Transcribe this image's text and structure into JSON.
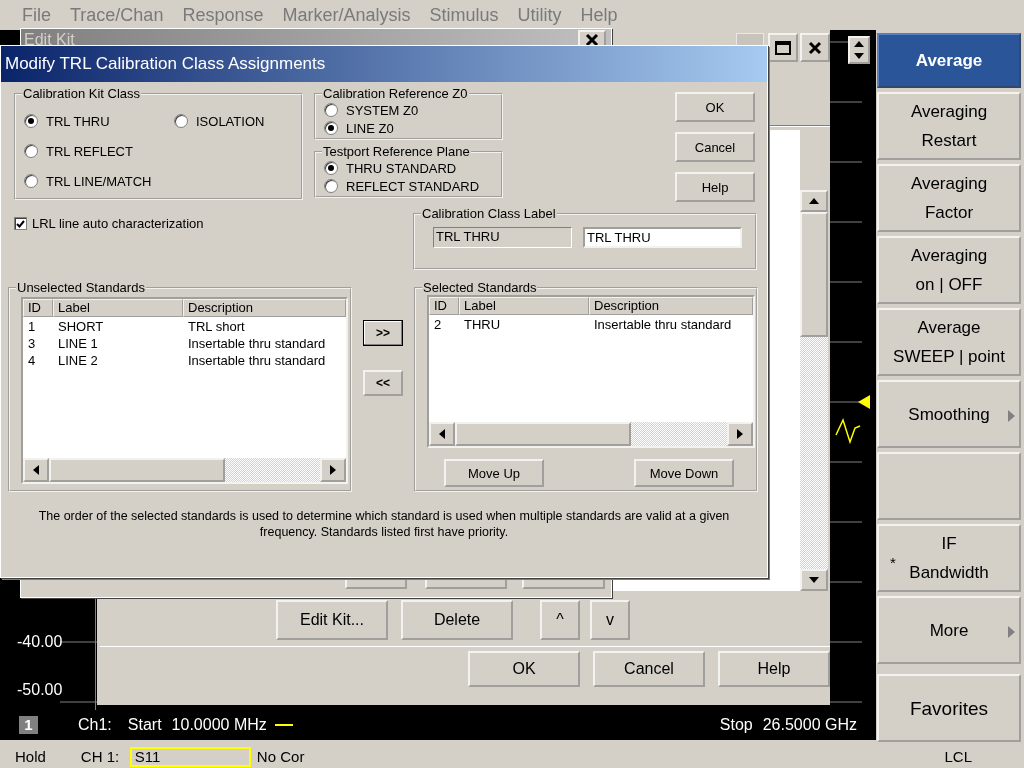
{
  "menu_bar": {
    "items": [
      {
        "label": "File",
        "disabled": true
      },
      {
        "label": "Trace/Chan",
        "disabled": true
      },
      {
        "label": "Response",
        "disabled": true
      },
      {
        "label": "Marker/Analysis",
        "disabled": true
      },
      {
        "label": "Stimulus",
        "disabled": true
      },
      {
        "label": "Utility",
        "disabled": true
      },
      {
        "label": "Help",
        "disabled": true
      }
    ]
  },
  "trace_area": {
    "y_labels": [
      "-40.00",
      "-50.00"
    ],
    "channel_number": "1",
    "channel": "Ch1:",
    "start_label": "Start",
    "start_value": "10.0000 MHz",
    "stop_label": "Stop",
    "stop_value": "26.5000 GHz"
  },
  "calibration_window": {
    "actions": [
      "Edit Kit...",
      "Delete",
      "^",
      "v"
    ],
    "buttons": [
      "OK",
      "Cancel",
      "Help"
    ]
  },
  "edit_kit_window": {
    "title": "Edit Kit"
  },
  "trl_dialog": {
    "title": "Modify TRL Calibration Class Assignments",
    "kit_class": {
      "label": "Calibration Kit Class",
      "options": [
        {
          "label": "TRL THRU",
          "selected": true
        },
        {
          "label": "ISOLATION",
          "selected": false
        },
        {
          "label": "TRL REFLECT",
          "selected": false
        },
        {
          "label": "TRL LINE/MATCH",
          "selected": false
        }
      ]
    },
    "reference_z0": {
      "label": "Calibration Reference Z0",
      "options": [
        {
          "label": "SYSTEM Z0",
          "selected": false
        },
        {
          "label": "LINE Z0",
          "selected": true
        }
      ]
    },
    "reference_plane": {
      "label": "Testport Reference Plane",
      "options": [
        {
          "label": "THRU STANDARD",
          "selected": true
        },
        {
          "label": "REFLECT STANDARD",
          "selected": false
        }
      ]
    },
    "buttons": [
      "OK",
      "Cancel",
      "Help"
    ],
    "lrl_auto": {
      "label": "LRL line auto characterization",
      "checked": true
    },
    "class_label": {
      "label": "Calibration Class Label",
      "current": "TRL THRU",
      "value": "TRL THRU"
    },
    "unselected": {
      "label": "Unselected Standards",
      "columns": [
        "ID",
        "Label",
        "Description"
      ],
      "rows": [
        [
          "1",
          "SHORT",
          "TRL short"
        ],
        [
          "3",
          "LINE 1",
          "Insertable thru standard"
        ],
        [
          "4",
          "LINE 2",
          "Insertable thru standard"
        ]
      ]
    },
    "add_button": ">>",
    "remove_button": "<<",
    "selected": {
      "label": "Selected Standards",
      "columns": [
        "ID",
        "Label",
        "Description"
      ],
      "rows": [
        [
          "2",
          "THRU",
          "Insertable thru standard"
        ]
      ]
    },
    "move_up": "Move Up",
    "move_down": "Move Down",
    "note": "The order of the selected standards is used to determine which standard is used when multiple standards are valid at a given frequency. Standards listed first have priority."
  },
  "softkeys": [
    {
      "lines": [
        "Average"
      ],
      "selected": true,
      "submenu": false
    },
    {
      "lines": [
        "Averaging",
        "Restart"
      ],
      "selected": false,
      "submenu": false
    },
    {
      "lines": [
        "Averaging",
        "Factor"
      ],
      "selected": false,
      "submenu": false
    },
    {
      "lines": [
        "Averaging",
        "on | OFF"
      ],
      "selected": false,
      "submenu": false
    },
    {
      "lines": [
        "Average",
        "SWEEP | point"
      ],
      "selected": false,
      "submenu": false
    },
    {
      "lines": [
        "Smoothing"
      ],
      "selected": false,
      "submenu": true
    },
    {
      "selected": false,
      "submenu": false
    },
    {
      "lines": [
        "IF",
        "Bandwidth"
      ],
      "prefix": "*",
      "selected": false,
      "submenu": false
    },
    {
      "lines": [
        "More"
      ],
      "selected": false,
      "submenu": true
    },
    {
      "lines": [
        "Favorites"
      ],
      "selected": false,
      "submenu": false
    }
  ],
  "status_bar": {
    "mode": "Hold",
    "channel": "CH 1:",
    "parameter": "S11",
    "correction": "No Cor",
    "remote": "LCL"
  }
}
